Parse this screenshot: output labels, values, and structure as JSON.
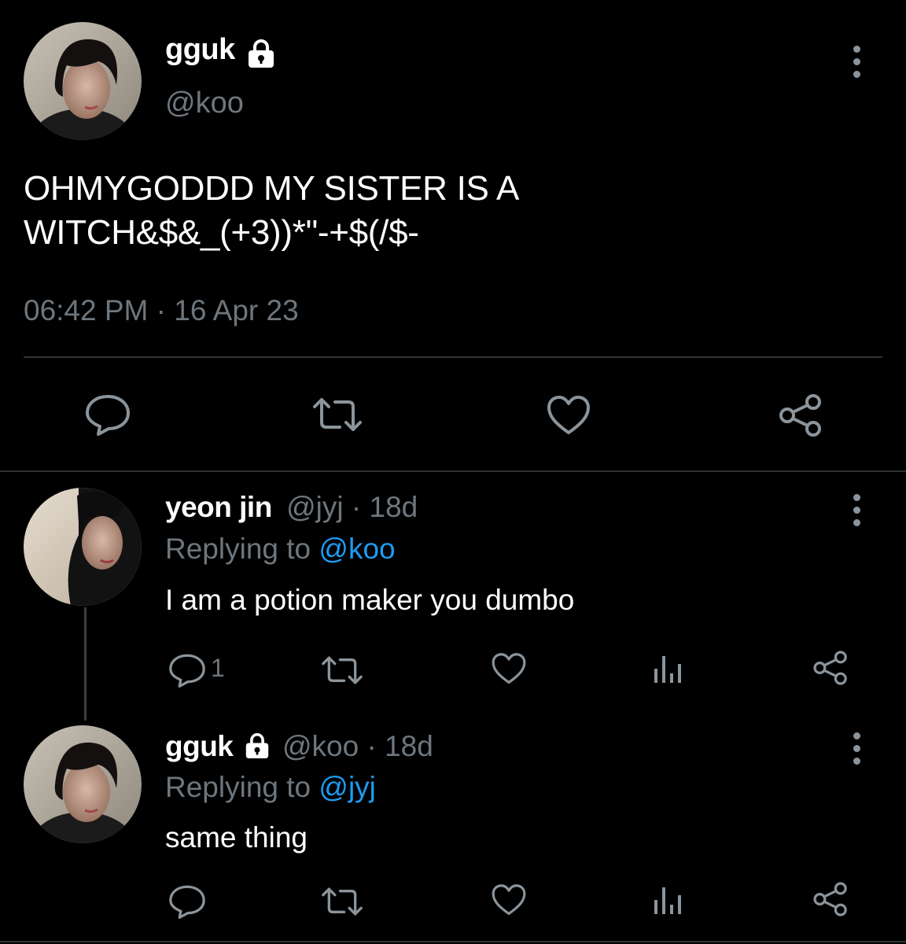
{
  "main_tweet": {
    "display_name": "gguk",
    "handle": "@koo",
    "text_line1": "OHMYGODDD MY SISTER IS A",
    "text_line2": "WITCH&$&_(+3))*\"-+$(/$-",
    "time": "06:42 PM",
    "separator": "·",
    "date": "16 Apr 23"
  },
  "replies": [
    {
      "display_name": "yeon jin",
      "handle": "@jyj",
      "age": "· 18d",
      "replying_prefix": "Replying to",
      "replying_handle": "@koo",
      "text": "I am a potion maker you dumbo",
      "reply_count": "1"
    },
    {
      "display_name": "gguk",
      "handle": "@koo",
      "age": "· 18d",
      "replying_prefix": "Replying to",
      "replying_handle": "@jyj",
      "text": "same thing",
      "reply_count": ""
    }
  ],
  "icons": {
    "more": "more-vertical-icon",
    "lock": "lock-icon",
    "reply": "comment-icon",
    "retweet": "retweet-icon",
    "like": "heart-icon",
    "stats": "analytics-icon",
    "share": "share-icon"
  },
  "colors": {
    "background": "#000000",
    "text": "#ffffff",
    "secondary": "#6e767d",
    "link": "#1d9bf0",
    "divider": "#2f3336"
  }
}
